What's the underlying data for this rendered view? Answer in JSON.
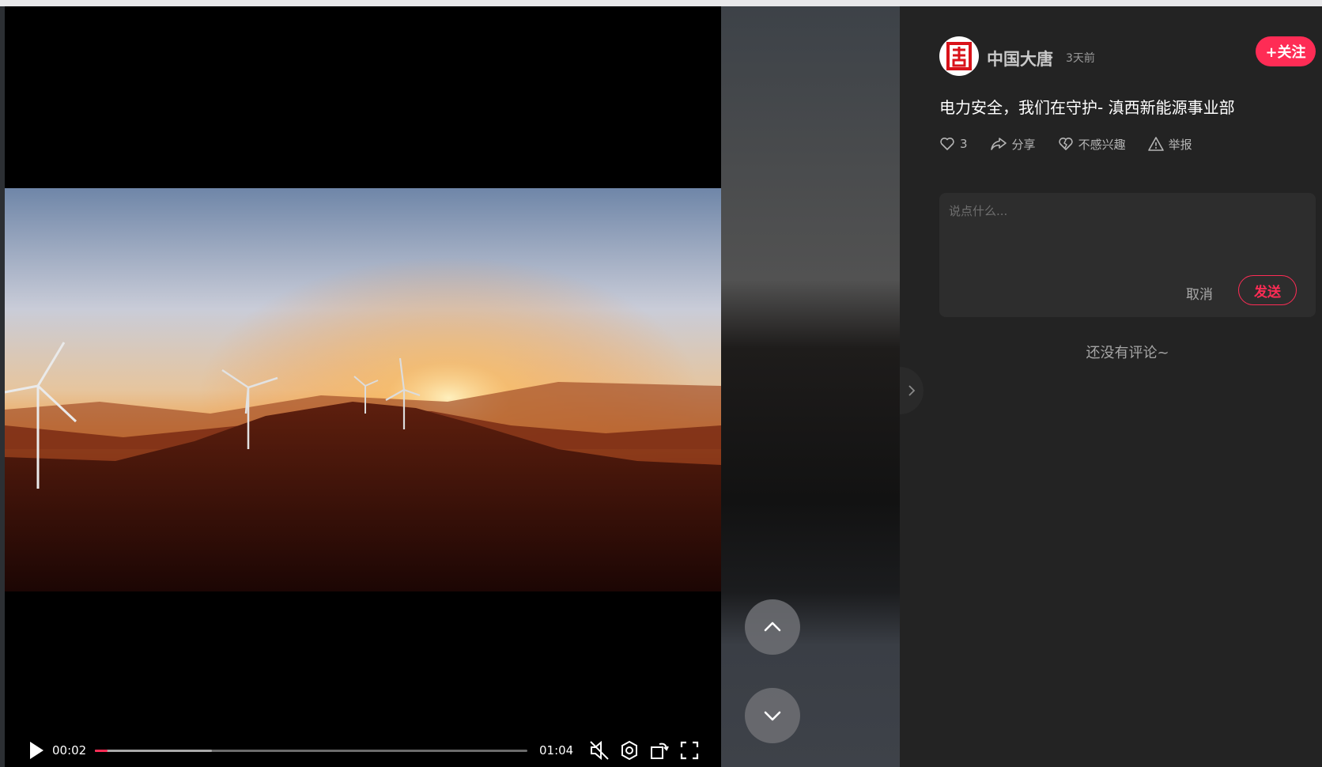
{
  "player": {
    "current_time": "00:02",
    "duration": "01:04",
    "played_fraction": 0.03,
    "buffered_fraction": 0.27
  },
  "author": {
    "name": "中国大唐",
    "posted": "3天前",
    "follow_label": "+关注"
  },
  "post": {
    "title": "电力安全，我们在守护- 滇西新能源事业部"
  },
  "actions": {
    "like_count": "3",
    "share_label": "分享",
    "not_interested_label": "不感兴趣",
    "report_label": "举报"
  },
  "comment": {
    "placeholder": "说点什么...",
    "cancel_label": "取消",
    "send_label": "发送",
    "empty_text": "还没有评论~"
  },
  "colors": {
    "accent": "#fe2c55",
    "panel_bg": "#232323"
  }
}
